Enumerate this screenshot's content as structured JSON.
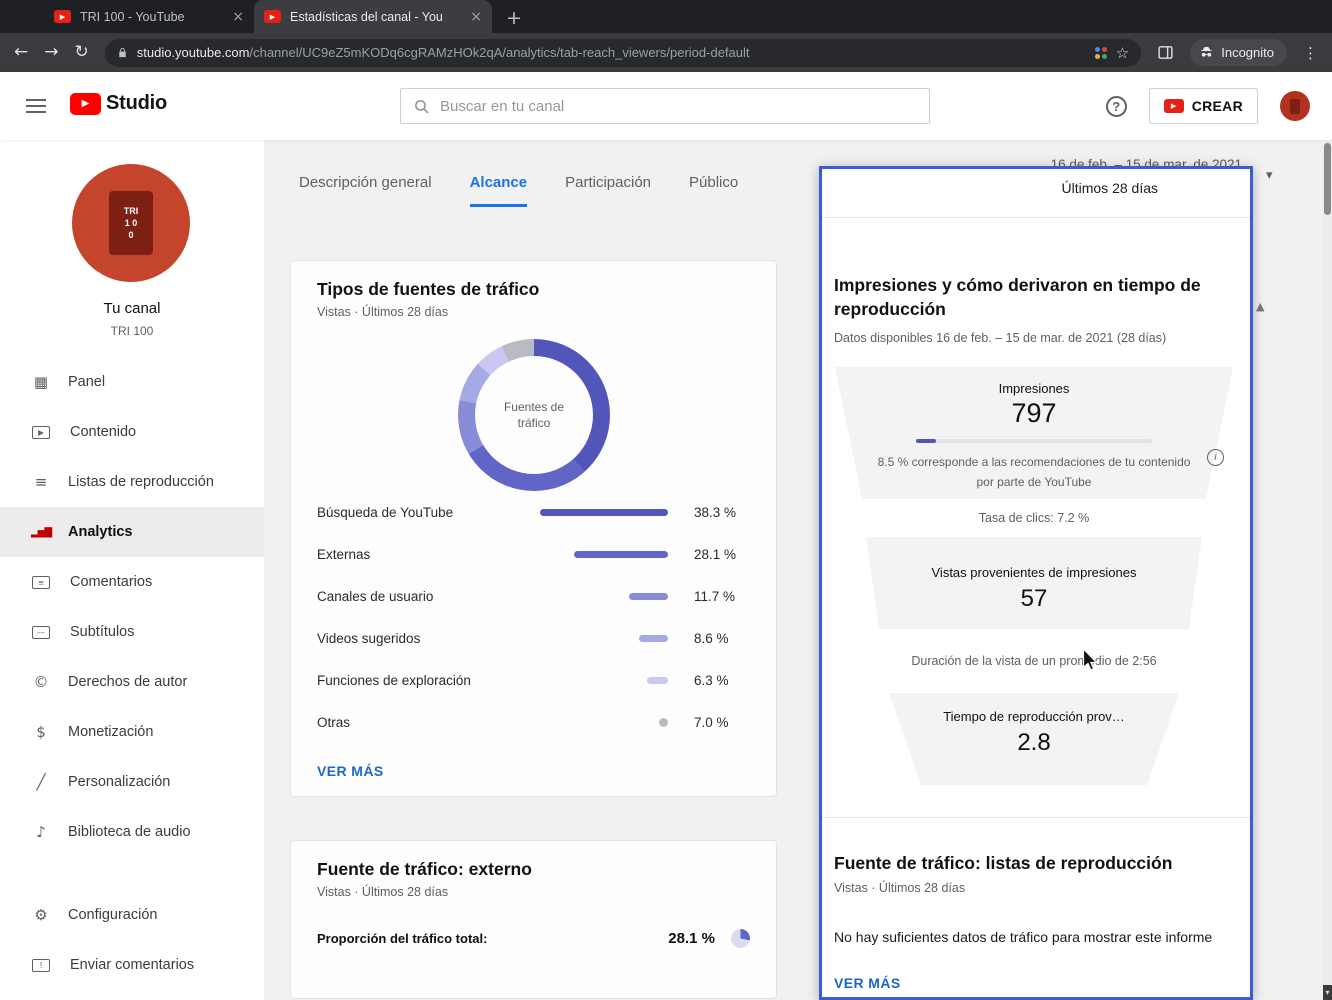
{
  "palette": {
    "accent_indigo": "#5156b8",
    "link_blue": "#1b66c9",
    "active_tab_blue": "#1a73e8",
    "selection_border_blue": "#3d5bd9",
    "studio_red": "#c00000",
    "avatar_red": "#c5442c"
  },
  "browser": {
    "tabs": [
      {
        "title": "TRI 100 - YouTube"
      },
      {
        "title": "Estadísticas del canal - You"
      }
    ],
    "url_domain": "studio.youtube.com",
    "url_path": "/channel/UC9eZ5mKODq6cgRAMzHOk2qA/analytics/tab-reach_viewers/period-default",
    "incognito_label": "Incognito"
  },
  "studio_header": {
    "brand": "Studio",
    "search_placeholder": "Buscar en tu canal",
    "create_label": "CREAR"
  },
  "sidebar": {
    "channel_name": "Tu canal",
    "channel_handle": "TRI 100",
    "avatar_lines": [
      "TRI",
      "1 0",
      "0"
    ],
    "items": [
      {
        "id": "panel",
        "label": "Panel",
        "icon": "dashboard-icon",
        "glyph": "▦"
      },
      {
        "id": "contenido",
        "label": "Contenido",
        "icon": "content-videos-icon",
        "glyph": "▶",
        "boxed": true
      },
      {
        "id": "listas",
        "label": "Listas de reproducción",
        "icon": "playlists-icon",
        "glyph": "≡"
      },
      {
        "id": "analytics",
        "label": "Analytics",
        "icon": "analytics-bars-icon",
        "glyph": "▂▅▇",
        "active": true
      },
      {
        "id": "comentarios",
        "label": "Comentarios",
        "icon": "comments-icon",
        "glyph": "≡",
        "boxed": true
      },
      {
        "id": "subtitulos",
        "label": "Subtítulos",
        "icon": "subtitles-icon",
        "glyph": "––",
        "boxed": true
      },
      {
        "id": "derechos",
        "label": "Derechos de autor",
        "icon": "copyright-icon",
        "glyph": "©"
      },
      {
        "id": "monetizacion",
        "label": "Monetización",
        "icon": "monetization-icon",
        "glyph": "$"
      },
      {
        "id": "personalizacion",
        "label": "Personalización",
        "icon": "customization-wand-icon",
        "glyph": "╱"
      },
      {
        "id": "biblioteca",
        "label": "Biblioteca de audio",
        "icon": "audio-library-icon",
        "glyph": "♪"
      }
    ],
    "footer_items": [
      {
        "id": "configuracion",
        "label": "Configuración",
        "icon": "settings-gear-icon",
        "glyph": "⚙"
      },
      {
        "id": "enviar",
        "label": "Enviar comentarios",
        "icon": "feedback-icon",
        "glyph": "!",
        "boxed": true
      }
    ]
  },
  "main": {
    "tabs": [
      {
        "label": "Descripción general"
      },
      {
        "label": "Alcance",
        "active": true
      },
      {
        "label": "Participación"
      },
      {
        "label": "Público"
      }
    ],
    "date_range": "16 de feb. – 15 de mar. de 2021",
    "period_label": "Últimos 28 días"
  },
  "traffic_card": {
    "title": "Tipos de fuentes de tráfico",
    "subtitle": "Vistas · Últimos 28 días",
    "donut_center_label": "Fuentes de tráfico",
    "see_more": "VER MÁS"
  },
  "external_card": {
    "title": "Fuente de tráfico: externo",
    "subtitle": "Vistas · Últimos 28 días",
    "row_label": "Proporción del tráfico total:",
    "row_value": "28.1 %",
    "share_pct": 28.1
  },
  "overlay": {
    "period_label": "Últimos 28 días",
    "impressions": {
      "title": "Impresiones y cómo derivaron en tiempo de reproducción",
      "availability": "Datos disponibles 16 de feb. – 15 de mar. de 2021 (28 días)",
      "impressions_label": "Impresiones",
      "impressions_value": "797",
      "recommended_pct": 8.5,
      "recommended_note": "8.5 % corresponde a las recomendaciones de tu contenido por parte de YouTube",
      "ctr_line": "Tasa de clics: 7.2 %",
      "views_label": "Vistas provenientes de impresiones",
      "views_value": "57",
      "avg_duration_line": "Duración de la vista de un promedio de 2:56",
      "watch_time_label": "Tiempo de reproducción prov…",
      "watch_time_value": "2.8"
    },
    "playlists": {
      "title": "Fuente de tráfico: listas de reproducción",
      "subtitle": "Vistas · Últimos 28 días",
      "empty_message": "No hay suficientes datos de tráfico para mostrar este informe",
      "see_more": "VER MÁS"
    }
  },
  "chart_data": [
    {
      "type": "pie",
      "title": "Tipos de fuentes de tráfico",
      "subtitle": "Vistas · Últimos 28 días",
      "center_label": "Fuentes de tráfico",
      "categories": [
        "Búsqueda de YouTube",
        "Externas",
        "Canales de usuario",
        "Videos sugeridos",
        "Funciones de exploración",
        "Otras"
      ],
      "values": [
        38.3,
        28.1,
        11.7,
        8.6,
        6.3,
        7.0
      ],
      "unit": "%",
      "colors": [
        "#5156b8",
        "#6065c6",
        "#878cd8",
        "#a5a9e5",
        "#c7c9f1",
        "#b8bbc1"
      ],
      "markers": [
        "bar",
        "bar",
        "bar",
        "bar",
        "bar",
        "dot"
      ],
      "legend_position": "below"
    },
    {
      "type": "funnel",
      "title": "Impresiones y cómo derivaron en tiempo de reproducción",
      "stages": [
        {
          "label": "Impresiones",
          "value": 797
        },
        {
          "label": "Vistas provenientes de impresiones",
          "value": 57
        },
        {
          "label": "Tiempo de reproducción prov…",
          "value": 2.8
        }
      ],
      "recommended_from_youtube_pct": 8.5,
      "ctr_pct": 7.2,
      "avg_view_duration": "2:56"
    },
    {
      "type": "pie",
      "title": "Fuente de tráfico: externo",
      "categories": [
        "Proporción del tráfico total"
      ],
      "values": [
        28.1
      ],
      "unit": "%"
    }
  ]
}
